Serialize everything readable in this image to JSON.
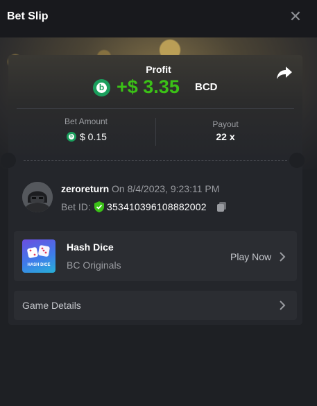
{
  "header": {
    "title": "Bet Slip"
  },
  "summary": {
    "profit_label": "Profit",
    "profit_amount": "+$ 3.35",
    "profit_currency": "BCD",
    "bet_amount_label": "Bet Amount",
    "bet_amount_value": "$ 0.15",
    "payout_label": "Payout",
    "payout_value": "22 x"
  },
  "player": {
    "username": "zeroreturn",
    "date_text": "On 8/4/2023, 9:23:11 PM",
    "bet_id_label": "Bet ID:",
    "bet_id_value": "353410396108882002"
  },
  "game": {
    "name": "Hash Dice",
    "provider": "BC Originals",
    "thumb_text": "HASH DICE",
    "play_label": "Play Now"
  },
  "details": {
    "label": "Game Details"
  },
  "colors": {
    "accent_green": "#3bc117",
    "coin_green": "#1a9e5c",
    "background": "#1e2024",
    "card": "#24262b",
    "row": "#2b2d32"
  },
  "icons": {
    "close": "close-icon",
    "share": "share-icon",
    "coin": "bcd-coin-icon",
    "shield": "verified-shield-icon",
    "copy": "copy-icon",
    "chevron": "chevron-right-icon"
  }
}
